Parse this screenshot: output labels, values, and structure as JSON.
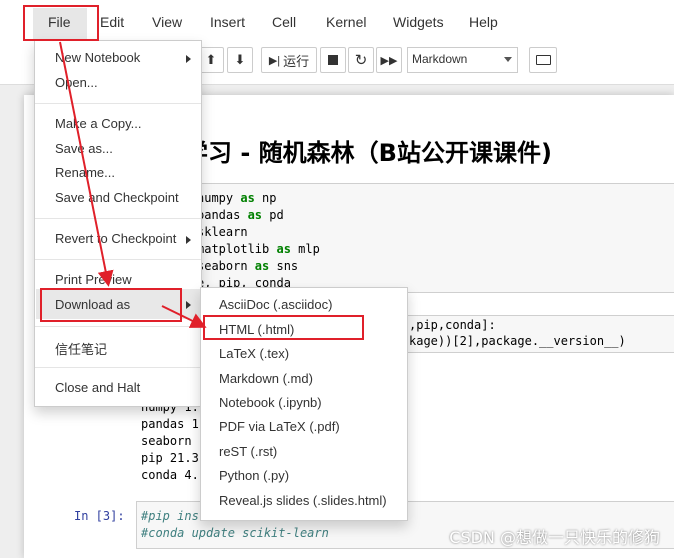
{
  "menubar": {
    "items": [
      "File",
      "Edit",
      "View",
      "Insert",
      "Cell",
      "Kernel",
      "Widgets",
      "Help"
    ]
  },
  "toolbar": {
    "run_label": "运行",
    "cell_type": "Markdown"
  },
  "file_menu": {
    "items": {
      "new_notebook": "New Notebook",
      "open": "Open...",
      "make_copy": "Make a Copy...",
      "save_as": "Save as...",
      "rename": "Rename...",
      "save_checkpoint": "Save and Checkpoint",
      "revert_checkpoint": "Revert to Checkpoint",
      "print_preview": "Print Preview",
      "download_as": "Download as",
      "trusted_notebook": "信任笔记",
      "close_halt": "Close and Halt"
    }
  },
  "download_submenu": {
    "items": [
      "AsciiDoc (.asciidoc)",
      "HTML (.html)",
      "LaTeX (.tex)",
      "Markdown (.md)",
      "Notebook (.ipynb)",
      "PDF via LaTeX (.pdf)",
      "reST (.rst)",
      "Python (.py)",
      "Reveal.js slides (.slides.html)"
    ]
  },
  "notebook": {
    "title": "学习 - 随机森林（B站公开课课件)",
    "cell1_lines": [
      {
        "pre": "numpy ",
        "kw": "as",
        "post": " np"
      },
      {
        "pre": "pandas ",
        "kw": "as",
        "post": " pd"
      },
      {
        "pre": "sklearn",
        "kw": "",
        "post": ""
      },
      {
        "pre": "matplotlib ",
        "kw": "as",
        "post": " mlp"
      },
      {
        "pre": "seaborn ",
        "kw": "as",
        "post": " sns"
      },
      {
        "pre": "e, pip, conda",
        "kw": "",
        "post": ""
      }
    ],
    "cell2_lines": [
      ",pip,conda]:",
      "kage))[2],package.__version__)"
    ],
    "output_lines": [
      "numpy 1.",
      "pandas 1.",
      "seaborn (",
      "pip 21.3.",
      "conda 4.1"
    ],
    "cell3_prompt": "In  [3]:",
    "cell3_lines": [
      "#pip insta...",
      "#conda update scikit-learn"
    ]
  },
  "watermark": "CSDN @想做一只快乐的修狗"
}
